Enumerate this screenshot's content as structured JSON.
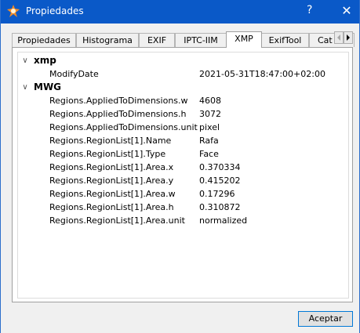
{
  "window": {
    "title": "Propiedades",
    "help_icon": "question-mark",
    "close_icon": "x"
  },
  "tabs": [
    {
      "label": "Propiedades",
      "active": false
    },
    {
      "label": "Histograma",
      "active": false
    },
    {
      "label": "EXIF",
      "active": false
    },
    {
      "label": "IPTC-IIM",
      "active": false
    },
    {
      "label": "XMP",
      "active": true
    },
    {
      "label": "ExifTool",
      "active": false
    },
    {
      "label": "Cat",
      "active": false
    }
  ],
  "groups": [
    {
      "name": "xmp",
      "items": [
        {
          "key": "ModifyDate",
          "value": "2021-05-31T18:47:00+02:00"
        }
      ]
    },
    {
      "name": "MWG",
      "items": [
        {
          "key": "Regions.AppliedToDimensions.w",
          "value": "4608"
        },
        {
          "key": "Regions.AppliedToDimensions.h",
          "value": "3072"
        },
        {
          "key": "Regions.AppliedToDimensions.unit",
          "value": "pixel"
        },
        {
          "key": "Regions.RegionList[1].Name",
          "value": "Rafa"
        },
        {
          "key": "Regions.RegionList[1].Type",
          "value": "Face"
        },
        {
          "key": "Regions.RegionList[1].Area.x",
          "value": "0.370334"
        },
        {
          "key": "Regions.RegionList[1].Area.y",
          "value": "0.415202"
        },
        {
          "key": "Regions.RegionList[1].Area.w",
          "value": "0.17296"
        },
        {
          "key": "Regions.RegionList[1].Area.h",
          "value": "0.310872"
        },
        {
          "key": "Regions.RegionList[1].Area.unit",
          "value": "normalized"
        }
      ]
    }
  ],
  "buttons": {
    "ok_label": "Aceptar"
  },
  "colors": {
    "titlebar": "#0a59c8",
    "accent": "#0078d7"
  }
}
